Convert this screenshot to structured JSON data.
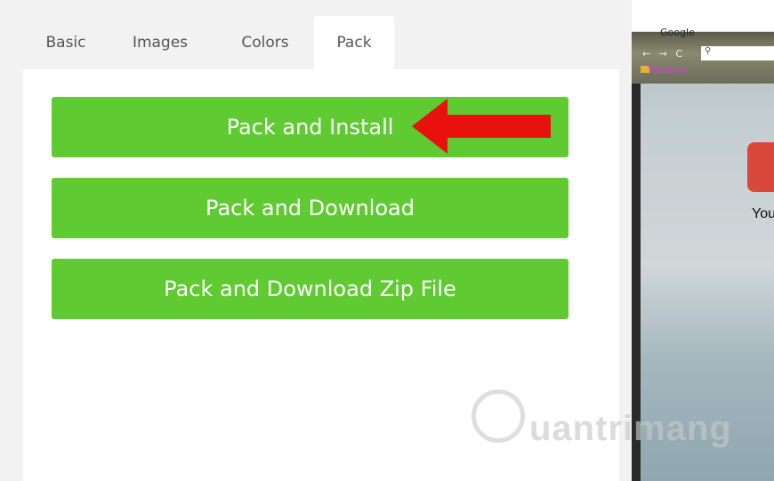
{
  "tabs": [
    {
      "label": "Basic"
    },
    {
      "label": "Images"
    },
    {
      "label": "Colors"
    },
    {
      "label": "Pack"
    }
  ],
  "active_tab": "Pack",
  "buttons": {
    "install": "Pack and Install",
    "download": "Pack and Download",
    "zip": "Pack and Download Zip File"
  },
  "colors": {
    "button_green": "#5fca32",
    "arrow_red": "#e8110c"
  },
  "preview": {
    "google": "Google",
    "nav": "← → C",
    "themes": "Themes",
    "you": "You"
  },
  "watermark": "uantrimang"
}
